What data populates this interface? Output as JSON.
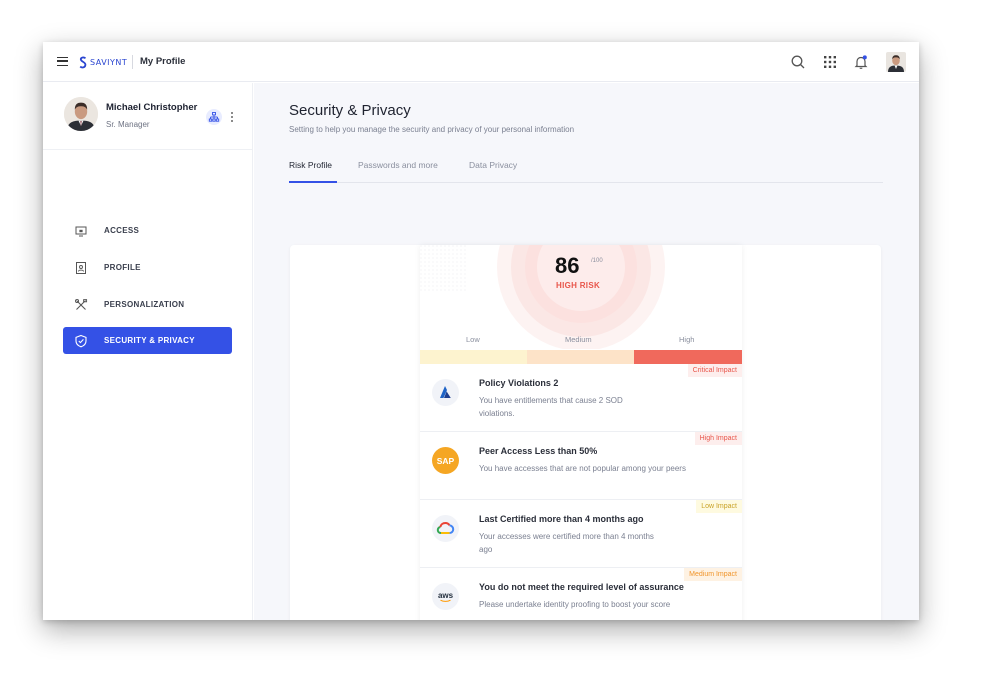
{
  "header": {
    "logo_text": "SAVIYNT",
    "title": "My Profile",
    "icons": [
      "menu-icon",
      "search-icon",
      "apps-grid-icon",
      "notification-bell-icon",
      "user-avatar"
    ]
  },
  "user": {
    "name": "Michael Christopher",
    "role": "Sr. Manager"
  },
  "sidebar": {
    "items": [
      {
        "label": "ACCESS",
        "icon": "monitor-icon",
        "active": false
      },
      {
        "label": "PROFILE",
        "icon": "id-card-icon",
        "active": false
      },
      {
        "label": "PERSONALIZATION",
        "icon": "tools-icon",
        "active": false
      },
      {
        "label": "SECURITY & PRIVACY",
        "icon": "shield-icon",
        "active": true
      }
    ]
  },
  "main": {
    "title": "Security & Privacy",
    "subtitle": "Setting to help you manage the security and privacy of your personal information",
    "tabs": [
      {
        "label": "Risk Profile",
        "active": true
      },
      {
        "label": "Passwords and more",
        "active": false
      },
      {
        "label": "Data Privacy",
        "active": false
      }
    ]
  },
  "risk": {
    "score": "86",
    "max": "/100",
    "level": "HIGH RISK",
    "scale": [
      "Low",
      "Medium",
      "High"
    ],
    "colors": {
      "low": "#fdf3cf",
      "medium": "#fde3c8",
      "high": "#f0695c",
      "accent": "#3451e6"
    }
  },
  "items": [
    {
      "title": "Policy Violations  2",
      "desc": "You have entitlements that cause 2 SOD violations.",
      "impact": "Critical Impact",
      "logo": "azure-logo-icon"
    },
    {
      "title": "Peer Access  Less than 50%",
      "desc": "You have accesses that are not popular among your peers",
      "impact": "High Impact",
      "logo": "sap-logo-icon",
      "logo_text": "SAP"
    },
    {
      "title": "Last Certified more than 4 months ago",
      "desc": "Your accesses were certified more than 4 months ago",
      "impact": "Low Impact",
      "logo": "google-cloud-logo-icon"
    },
    {
      "title": "You do not meet the required level of assurance",
      "desc": "Please undertake identity proofing to boost your score",
      "impact": "Medium Impact",
      "logo": "aws-logo-icon",
      "logo_text": "aws"
    }
  ]
}
